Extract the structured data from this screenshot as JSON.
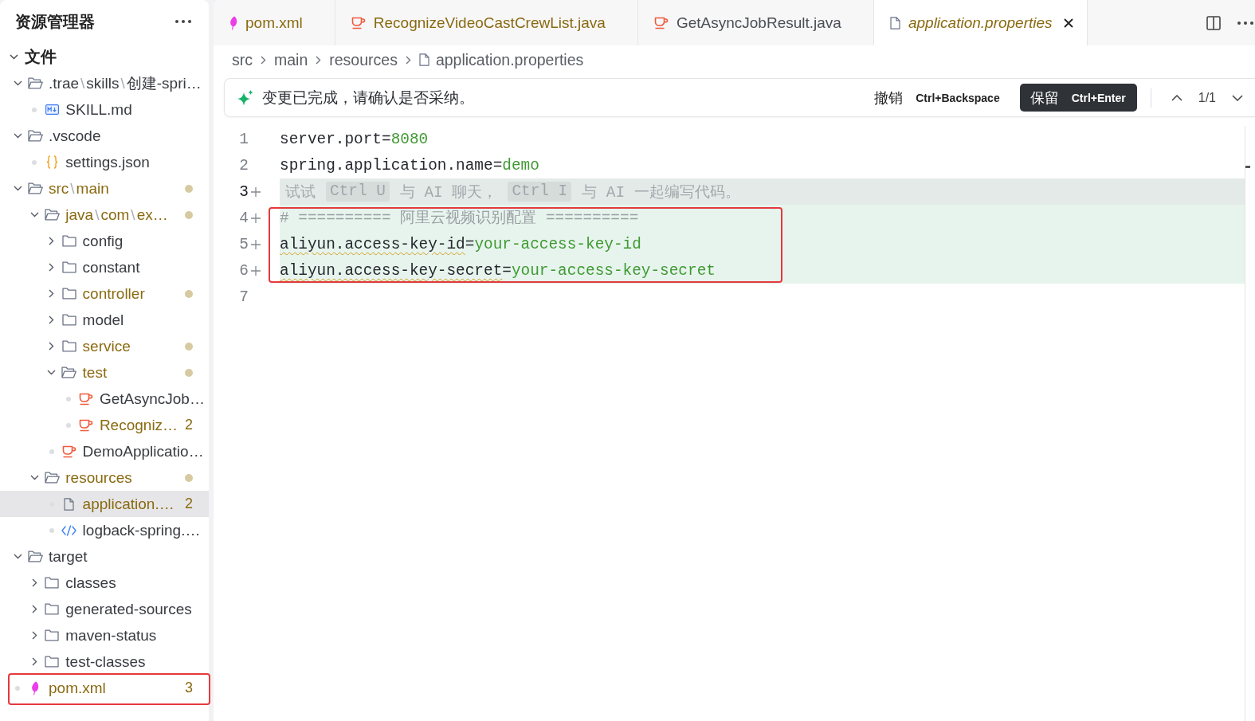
{
  "sidebar": {
    "title": "资源管理器",
    "section": {
      "title": "文件",
      "expanded": true,
      "items": [
        {
          "kind": "folder",
          "path": [
            ".trae",
            "skills",
            "创建-spri…"
          ],
          "separator": "\\",
          "expanded": true,
          "modified": false,
          "selected": false,
          "boxed": false,
          "children": [
            {
              "kind": "markdown",
              "label": "SKILL.md",
              "modified": false,
              "selected": false,
              "boxed": false
            }
          ]
        },
        {
          "kind": "folder",
          "label": ".vscode",
          "expanded": true,
          "modified": false,
          "selected": false,
          "boxed": false,
          "children": [
            {
              "kind": "json",
              "label": "settings.json",
              "modified": false,
              "selected": false,
              "boxed": false
            }
          ]
        },
        {
          "kind": "folder",
          "path": [
            "src",
            "main"
          ],
          "separator": "\\",
          "expanded": true,
          "modified": true,
          "selected": false,
          "boxed": false,
          "children": [
            {
              "kind": "folder",
              "path": [
                "java",
                "com",
                "ex…"
              ],
              "separator": "\\",
              "expanded": true,
              "modified": true,
              "selected": false,
              "boxed": false,
              "children": [
                {
                  "kind": "folder",
                  "label": "config",
                  "expanded": false,
                  "modified": false,
                  "selected": false,
                  "boxed": false
                },
                {
                  "kind": "folder",
                  "label": "constant",
                  "expanded": false,
                  "modified": false,
                  "selected": false,
                  "boxed": false
                },
                {
                  "kind": "folder",
                  "label": "controller",
                  "expanded": false,
                  "modified": true,
                  "selected": false,
                  "boxed": false
                },
                {
                  "kind": "folder",
                  "label": "model",
                  "expanded": false,
                  "modified": false,
                  "selected": false,
                  "boxed": false
                },
                {
                  "kind": "folder",
                  "label": "service",
                  "expanded": false,
                  "modified": true,
                  "selected": false,
                  "boxed": false
                },
                {
                  "kind": "folder",
                  "label": "test",
                  "expanded": true,
                  "modified": true,
                  "selected": false,
                  "boxed": false,
                  "children": [
                    {
                      "kind": "java",
                      "label": "GetAsyncJob…",
                      "modified": false,
                      "selected": false,
                      "boxed": false
                    },
                    {
                      "kind": "java",
                      "label": "Recogniz…",
                      "badge": "2",
                      "modified": true,
                      "selected": false,
                      "boxed": false
                    }
                  ]
                },
                {
                  "kind": "java",
                  "label": "DemoApplicatio…",
                  "modified": false,
                  "selected": false,
                  "boxed": false
                }
              ]
            },
            {
              "kind": "folder",
              "label": "resources",
              "expanded": true,
              "modified": true,
              "selected": false,
              "boxed": false,
              "children": [
                {
                  "kind": "file",
                  "label": "application.…",
                  "badge": "2",
                  "modified": true,
                  "selected": true,
                  "boxed": false
                },
                {
                  "kind": "xml",
                  "label": "logback-spring.…",
                  "modified": false,
                  "selected": false,
                  "boxed": false
                }
              ]
            }
          ]
        },
        {
          "kind": "folder",
          "label": "target",
          "expanded": true,
          "modified": false,
          "selected": false,
          "boxed": false,
          "children": [
            {
              "kind": "folder",
              "label": "classes",
              "expanded": false,
              "modified": false,
              "selected": false,
              "boxed": false
            },
            {
              "kind": "folder",
              "label": "generated-sources",
              "expanded": false,
              "modified": false,
              "selected": false,
              "boxed": false
            },
            {
              "kind": "folder",
              "label": "maven-status",
              "expanded": false,
              "modified": false,
              "selected": false,
              "boxed": false
            },
            {
              "kind": "folder",
              "label": "test-classes",
              "expanded": false,
              "modified": false,
              "selected": false,
              "boxed": false
            }
          ]
        },
        {
          "kind": "maven",
          "label": "pom.xml",
          "badge": "3",
          "modified": true,
          "selected": false,
          "boxed": true
        }
      ]
    }
  },
  "tabs": [
    {
      "label": "pom.xml",
      "kind": "maven",
      "selected": false,
      "modified": true,
      "preview": false
    },
    {
      "label": "RecognizeVideoCastCrewList.java",
      "kind": "java",
      "selected": false,
      "modified": true,
      "preview": false
    },
    {
      "label": "GetAsyncJobResult.java",
      "kind": "java",
      "selected": false,
      "modified": false,
      "preview": false
    },
    {
      "label": "application.properties",
      "kind": "file",
      "selected": true,
      "modified": true,
      "preview": true
    }
  ],
  "breadcrumb": [
    {
      "label": "src",
      "kind": "folder"
    },
    {
      "label": "main",
      "kind": "folder"
    },
    {
      "label": "resources",
      "kind": "folder"
    },
    {
      "label": "application.properties",
      "kind": "file"
    }
  ],
  "review_bar": {
    "message": "变更已完成，请确认是否采纳。",
    "undo": {
      "label": "撤销",
      "shortcut": "Ctrl+Backspace"
    },
    "keep": {
      "label": "保留",
      "shortcut": "Ctrl+Enter"
    },
    "counter": "1/1"
  },
  "editor": {
    "lines": [
      {
        "number": "1",
        "added": false,
        "current": false,
        "boxed": false,
        "tokens": [
          {
            "kind": "key",
            "text": "server.port",
            "warning": false
          },
          {
            "kind": "operator",
            "text": "=",
            "warning": false
          },
          {
            "kind": "value",
            "text": "8080",
            "warning": false
          }
        ]
      },
      {
        "number": "2",
        "added": false,
        "current": false,
        "boxed": false,
        "tokens": [
          {
            "kind": "key",
            "text": "spring.application.name",
            "warning": false
          },
          {
            "kind": "operator",
            "text": "=",
            "warning": false
          },
          {
            "kind": "value",
            "text": "demo",
            "warning": false
          }
        ]
      },
      {
        "number": "3",
        "added": true,
        "current": true,
        "boxed": false,
        "tokens": [
          {
            "kind": "hint",
            "text": "试试",
            "warning": false
          },
          {
            "kind": "keycap",
            "text": "Ctrl U",
            "warning": false
          },
          {
            "kind": "hint",
            "text": "与 AI 聊天，",
            "warning": false
          },
          {
            "kind": "keycap",
            "text": "Ctrl I",
            "warning": false
          },
          {
            "kind": "hint",
            "text": "与 AI 一起编写代码。",
            "warning": false
          }
        ]
      },
      {
        "number": "4",
        "added": true,
        "current": false,
        "boxed": true,
        "tokens": [
          {
            "kind": "comment",
            "text": "# ========== 阿里云视频识别配置 ==========",
            "warning": false
          }
        ]
      },
      {
        "number": "5",
        "added": true,
        "current": false,
        "boxed": true,
        "tokens": [
          {
            "kind": "key",
            "text": "aliyun.access-key-id",
            "warning": true
          },
          {
            "kind": "operator",
            "text": "=",
            "warning": false
          },
          {
            "kind": "value",
            "text": "your-access-key-id",
            "warning": false
          }
        ]
      },
      {
        "number": "6",
        "added": true,
        "current": false,
        "boxed": true,
        "tokens": [
          {
            "kind": "key",
            "text": "aliyun.access-key-secret",
            "warning": true
          },
          {
            "kind": "operator",
            "text": "=",
            "warning": false
          },
          {
            "kind": "value",
            "text": "your-access-key-secret",
            "warning": false
          }
        ]
      },
      {
        "number": "7",
        "added": false,
        "current": false,
        "boxed": false
      }
    ]
  }
}
